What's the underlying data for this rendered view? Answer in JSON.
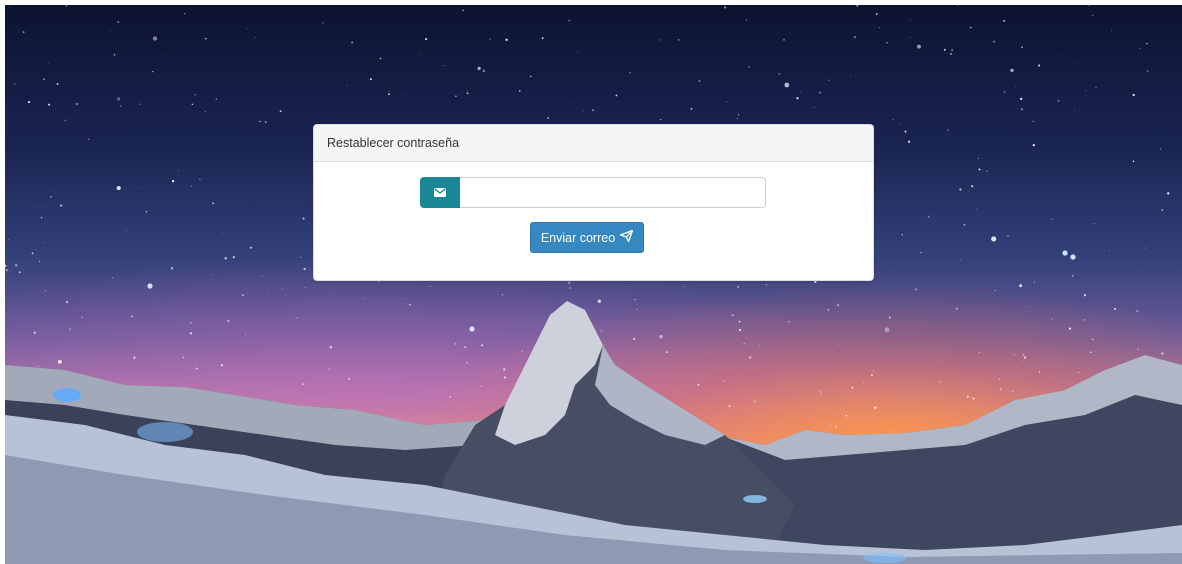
{
  "panel": {
    "title": "Restablecer contraseña"
  },
  "form": {
    "email_icon": "envelope-icon",
    "email_value": "",
    "email_placeholder": "",
    "submit_label": "Enviar correo",
    "submit_icon": "paper-plane-icon"
  },
  "colors": {
    "addon_bg": "#1b8796",
    "button_bg": "#3588c0",
    "panel_heading_bg": "#f5f5f5"
  }
}
